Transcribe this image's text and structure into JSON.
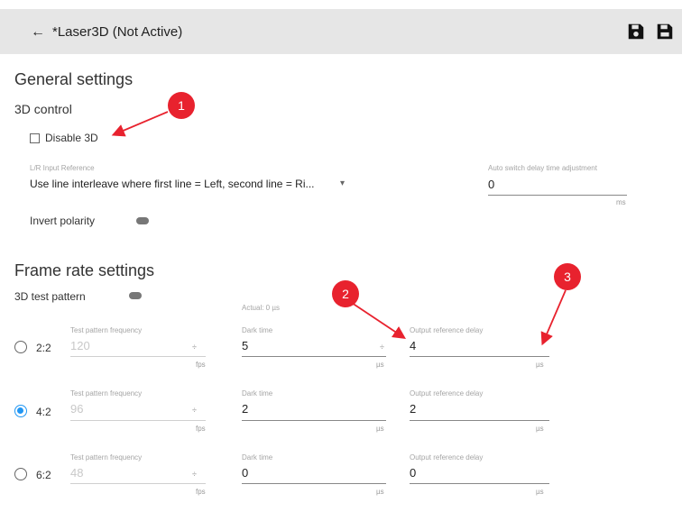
{
  "header": {
    "back_arrow": "←",
    "title": "*Laser3D (Not Active)"
  },
  "general": {
    "heading": "General settings",
    "control_heading": "3D control",
    "disable_3d_label": "Disable 3D",
    "lr_input": {
      "label": "L/R Input Reference",
      "value": "Use line interleave where first line = Left, second line = Ri...",
      "caret": "▾"
    },
    "auto_switch": {
      "label": "Auto switch delay time adjustment",
      "value": "0",
      "unit": "ms"
    },
    "invert_polarity_label": "Invert polarity"
  },
  "frame": {
    "heading": "Frame rate settings",
    "test_pattern_label": "3D test pattern",
    "actual_label": "Actual: 0 µs",
    "rows": [
      {
        "ratio": "2:2",
        "selected": false,
        "freq_label": "Test pattern frequency",
        "freq": "120",
        "freq_spin": "÷",
        "freq_unit": "fps",
        "dark_label": "Dark time",
        "dark": "5",
        "dark_spin": "÷",
        "dark_unit": "µs",
        "out_label": "Output reference delay",
        "out": "4",
        "out_unit": "µs"
      },
      {
        "ratio": "4:2",
        "selected": true,
        "freq_label": "Test pattern frequency",
        "freq": "96",
        "freq_spin": "÷",
        "freq_unit": "fps",
        "dark_label": "Dark time",
        "dark": "2",
        "dark_spin": "",
        "dark_unit": "µs",
        "out_label": "Output reference delay",
        "out": "2",
        "out_unit": "µs"
      },
      {
        "ratio": "6:2",
        "selected": false,
        "freq_label": "Test pattern frequency",
        "freq": "48",
        "freq_spin": "÷",
        "freq_unit": "fps",
        "dark_label": "Dark time",
        "dark": "0",
        "dark_spin": "",
        "dark_unit": "µs",
        "out_label": "Output reference delay",
        "out": "0",
        "out_unit": "µs"
      }
    ]
  },
  "annotations": {
    "one": "1",
    "two": "2",
    "three": "3"
  },
  "colors": {
    "accent": "#2196f3",
    "annotation": "#e8222e",
    "header_bg": "#e6e6e6"
  },
  "icons": {
    "save": "save-icon",
    "save_as": "save-as-icon"
  }
}
